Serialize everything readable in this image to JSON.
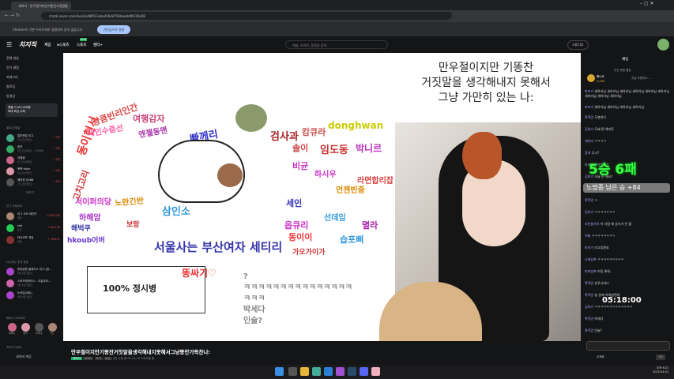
{
  "browser": {
    "tab_title": "세하리 - 만우절이지만기똥찬거짓말을...",
    "url": "chzzk.naver.com/live/a1d8f011ebad56dd793bee4d9f330e08",
    "infobar_text": "Chrome이 기본 브라우저로 설정되어 있지 않습니다",
    "infobar_button": "기본값으로 설정"
  },
  "site": {
    "logo": "치지직",
    "nav": [
      "게임",
      "e스포츠",
      "스포츠",
      "엔터+"
    ],
    "nav_badge": "NEW",
    "search_placeholder": "채널, 라이브, 동영상 검색",
    "studio": "스튜디오"
  },
  "sidebar": {
    "menu": [
      "전체 방송",
      "인기 클립",
      "카테고리",
      "팔로잉",
      "동영상"
    ],
    "banner": "레벨 3,105,208명\n최대 보급 수혜",
    "following_title": "팔로잉 채널",
    "following": [
      {
        "name": "얼투랜덤 리그",
        "sub": "리그오브레전드",
        "count": "• 7천"
      },
      {
        "name": "한치",
        "sub": "리그오브레전드 · 전략게임",
        "count": "• 3천"
      },
      {
        "name": "아벨림",
        "sub": "리그오브레전드",
        "count": "• 3천"
      },
      {
        "name": "뽀뽀 faker",
        "sub": "리그오브레전드",
        "count": "• 3천"
      },
      {
        "name": "해커한 JOJBB",
        "sub": "리그오브레전드",
        "count": "• 1천"
      }
    ],
    "more": "더보기",
    "popular_title": "인기 카테고리",
    "popular": [
      {
        "name": "리그 오브 레전드",
        "sub": "게임",
        "count": "• 105,783"
      },
      {
        "name": "talk",
        "sub": "토크",
        "count": "• 64,216"
      },
      {
        "name": "타르코프 게임",
        "sub": "게임",
        "count": "• 16,871"
      }
    ],
    "recommended_title": "다시보는 추천 방송",
    "recommended": [
      {
        "name": "한때공원 클래식스 리그 (한...",
        "sub": "4월 1일 업로드"
      },
      {
        "name": "스포츠캐릭터스 - 오늘부터...",
        "sub": "4월 1일 업로드"
      },
      {
        "name": "눈게임(세트)",
        "sub": "4월 1일 업로드"
      }
    ],
    "partners_title": "파트너 스트리머",
    "partners": [
      "세하리",
      "릴리",
      "라비네",
      "카노"
    ],
    "services_title": "치지직 서비스",
    "services": [
      "네이버 게임",
      "스튜디오"
    ]
  },
  "stream": {
    "title": "만우절이지만기똥찬거짓말을생각해내지못해서그냥똥만가득찬나:",
    "streamer": "세하리",
    "tags": [
      "세하리",
      "토크",
      "일상"
    ],
    "viewers": "4천 시청 중",
    "uptime": "00:11:15 스트리밍 중",
    "overlay_text": "만우절이지만 기똥찬\n거짓말을 생각해내지 못해서\n그냥 가만히 있는 나:",
    "chat_lines": [
      "?",
      "ㅋㅋㅋㅋㅋㅋㅋㅋㅋㅋㅋㅋㅋㅋㅋ",
      "ㅋㅋㅋ",
      "박세다",
      "인술?"
    ],
    "words": [
      [
        "동이현서",
        "#e33"
      ],
      [
        "상큼빈리인간",
        "#d44"
      ],
      [
        "데인수줍선",
        "#f6a"
      ],
      [
        "여행감자",
        "#c47"
      ],
      [
        "엔젤동맨",
        "#a3a"
      ],
      [
        "빠께리",
        "#33c"
      ],
      [
        "검사과",
        "#a22"
      ],
      [
        "캄큐라",
        "#c55"
      ],
      [
        "donghwan",
        "#cc0"
      ],
      [
        "솔이",
        "#c44"
      ],
      [
        "임도동",
        "#c33"
      ],
      [
        "박니르",
        "#b3b"
      ],
      [
        "고치고리",
        "#c33"
      ],
      [
        "삼인소",
        "#39d"
      ],
      [
        "서이퍼의당",
        "#c3c"
      ],
      [
        "노란긴반",
        "#d80"
      ],
      [
        "하해암",
        "#a3c"
      ],
      [
        "해벅쿠",
        "#33a"
      ],
      [
        "hkoub어버",
        "#63c"
      ],
      [
        "보랑",
        "#c33"
      ],
      [
        "비균",
        "#c3c"
      ],
      [
        "하시우",
        "#c3c"
      ],
      [
        "세인",
        "#33b"
      ],
      [
        "옵큐리",
        "#c3c"
      ],
      [
        "동이이",
        "#e33"
      ],
      [
        "가오가이가",
        "#c33"
      ],
      [
        "서울사는 부산여자 세티리",
        "#33a"
      ],
      [
        "똥싸기♡",
        "#e33"
      ],
      [
        "선데임",
        "#39d"
      ],
      [
        "라면합리잡",
        "#d44"
      ],
      [
        "언젠빈중",
        "#d80"
      ],
      [
        "습포삐",
        "#39d"
      ],
      [
        "멸라",
        "#a2a"
      ],
      [
        "100% 정시병",
        "#222"
      ]
    ]
  },
  "overlays": {
    "record": "5승 6패",
    "remaining": "노방종 남은 승 +84",
    "timer": "05:18:00"
  },
  "chat": {
    "header": "채팅",
    "ranking_title": "주간 후원 랭킹",
    "top_donor": "빵나르",
    "top_amount": "2,000",
    "ranking_hint": "지금 후원하고 ...",
    "messages": [
      {
        "user": "마포기",
        "text": "세하리님 세하리님 세하리님 세하리님 세하리님 세하리님 세하리님 세하리님 세하리님"
      },
      {
        "user": "마포기",
        "text": "세하리님 세하리님 세하리님 세하리님"
      },
      {
        "user": "흑묵망",
        "text": "도봉한다"
      },
      {
        "user": "김희기",
        "text": "도배 편 해리즌"
      },
      {
        "user": "세하리",
        "text": "ㅋㅋㅋㅋ"
      },
      {
        "user": "참새",
        "text": "무시?"
      },
      {
        "user": "마포기",
        "text": "목우릴련긴"
      },
      {
        "user": "김희기",
        "text": "오늘 안 해요?"
      },
      {
        "user": "세하리",
        "text": "10만원다지면"
      },
      {
        "user": "흑묵망",
        "text": "ㅋ"
      },
      {
        "user": "김희기",
        "text": "ㅋㅋㅋㅋㅋㅋㅋ"
      },
      {
        "user": "리안놀려라",
        "text": "이 사람 왜 승리가 안 올"
      },
      {
        "user": "어쩌",
        "text": "ㅋㅋㅋㅋㅋㅋㅋㅋ"
      },
      {
        "user": "마포기",
        "text": "리고있뭔요"
      },
      {
        "user": "나애삼축",
        "text": "ㅋㅋㅋㅋㅋㅋㅋㅋㅋ"
      },
      {
        "user": "마애삼축",
        "text": "어휴 롯데.."
      },
      {
        "user": "흑묵망",
        "text": "손푸나미나"
      },
      {
        "user": "흑묵망",
        "text": "늘 일에 치여살텐데"
      },
      {
        "user": "김희기",
        "text": "ㅋㅋㅋㅋㅋㅋㅋㅋㅋㅋㅋㅋㅋ"
      },
      {
        "user": "흑묵망",
        "text": "박세다"
      },
      {
        "user": "흑묵망",
        "text": "인술?"
      }
    ],
    "input_placeholder": "",
    "points": "무제한",
    "send": "채팅"
  },
  "taskbar": {
    "time": "오후 6:21",
    "date": "2025-04-01"
  }
}
